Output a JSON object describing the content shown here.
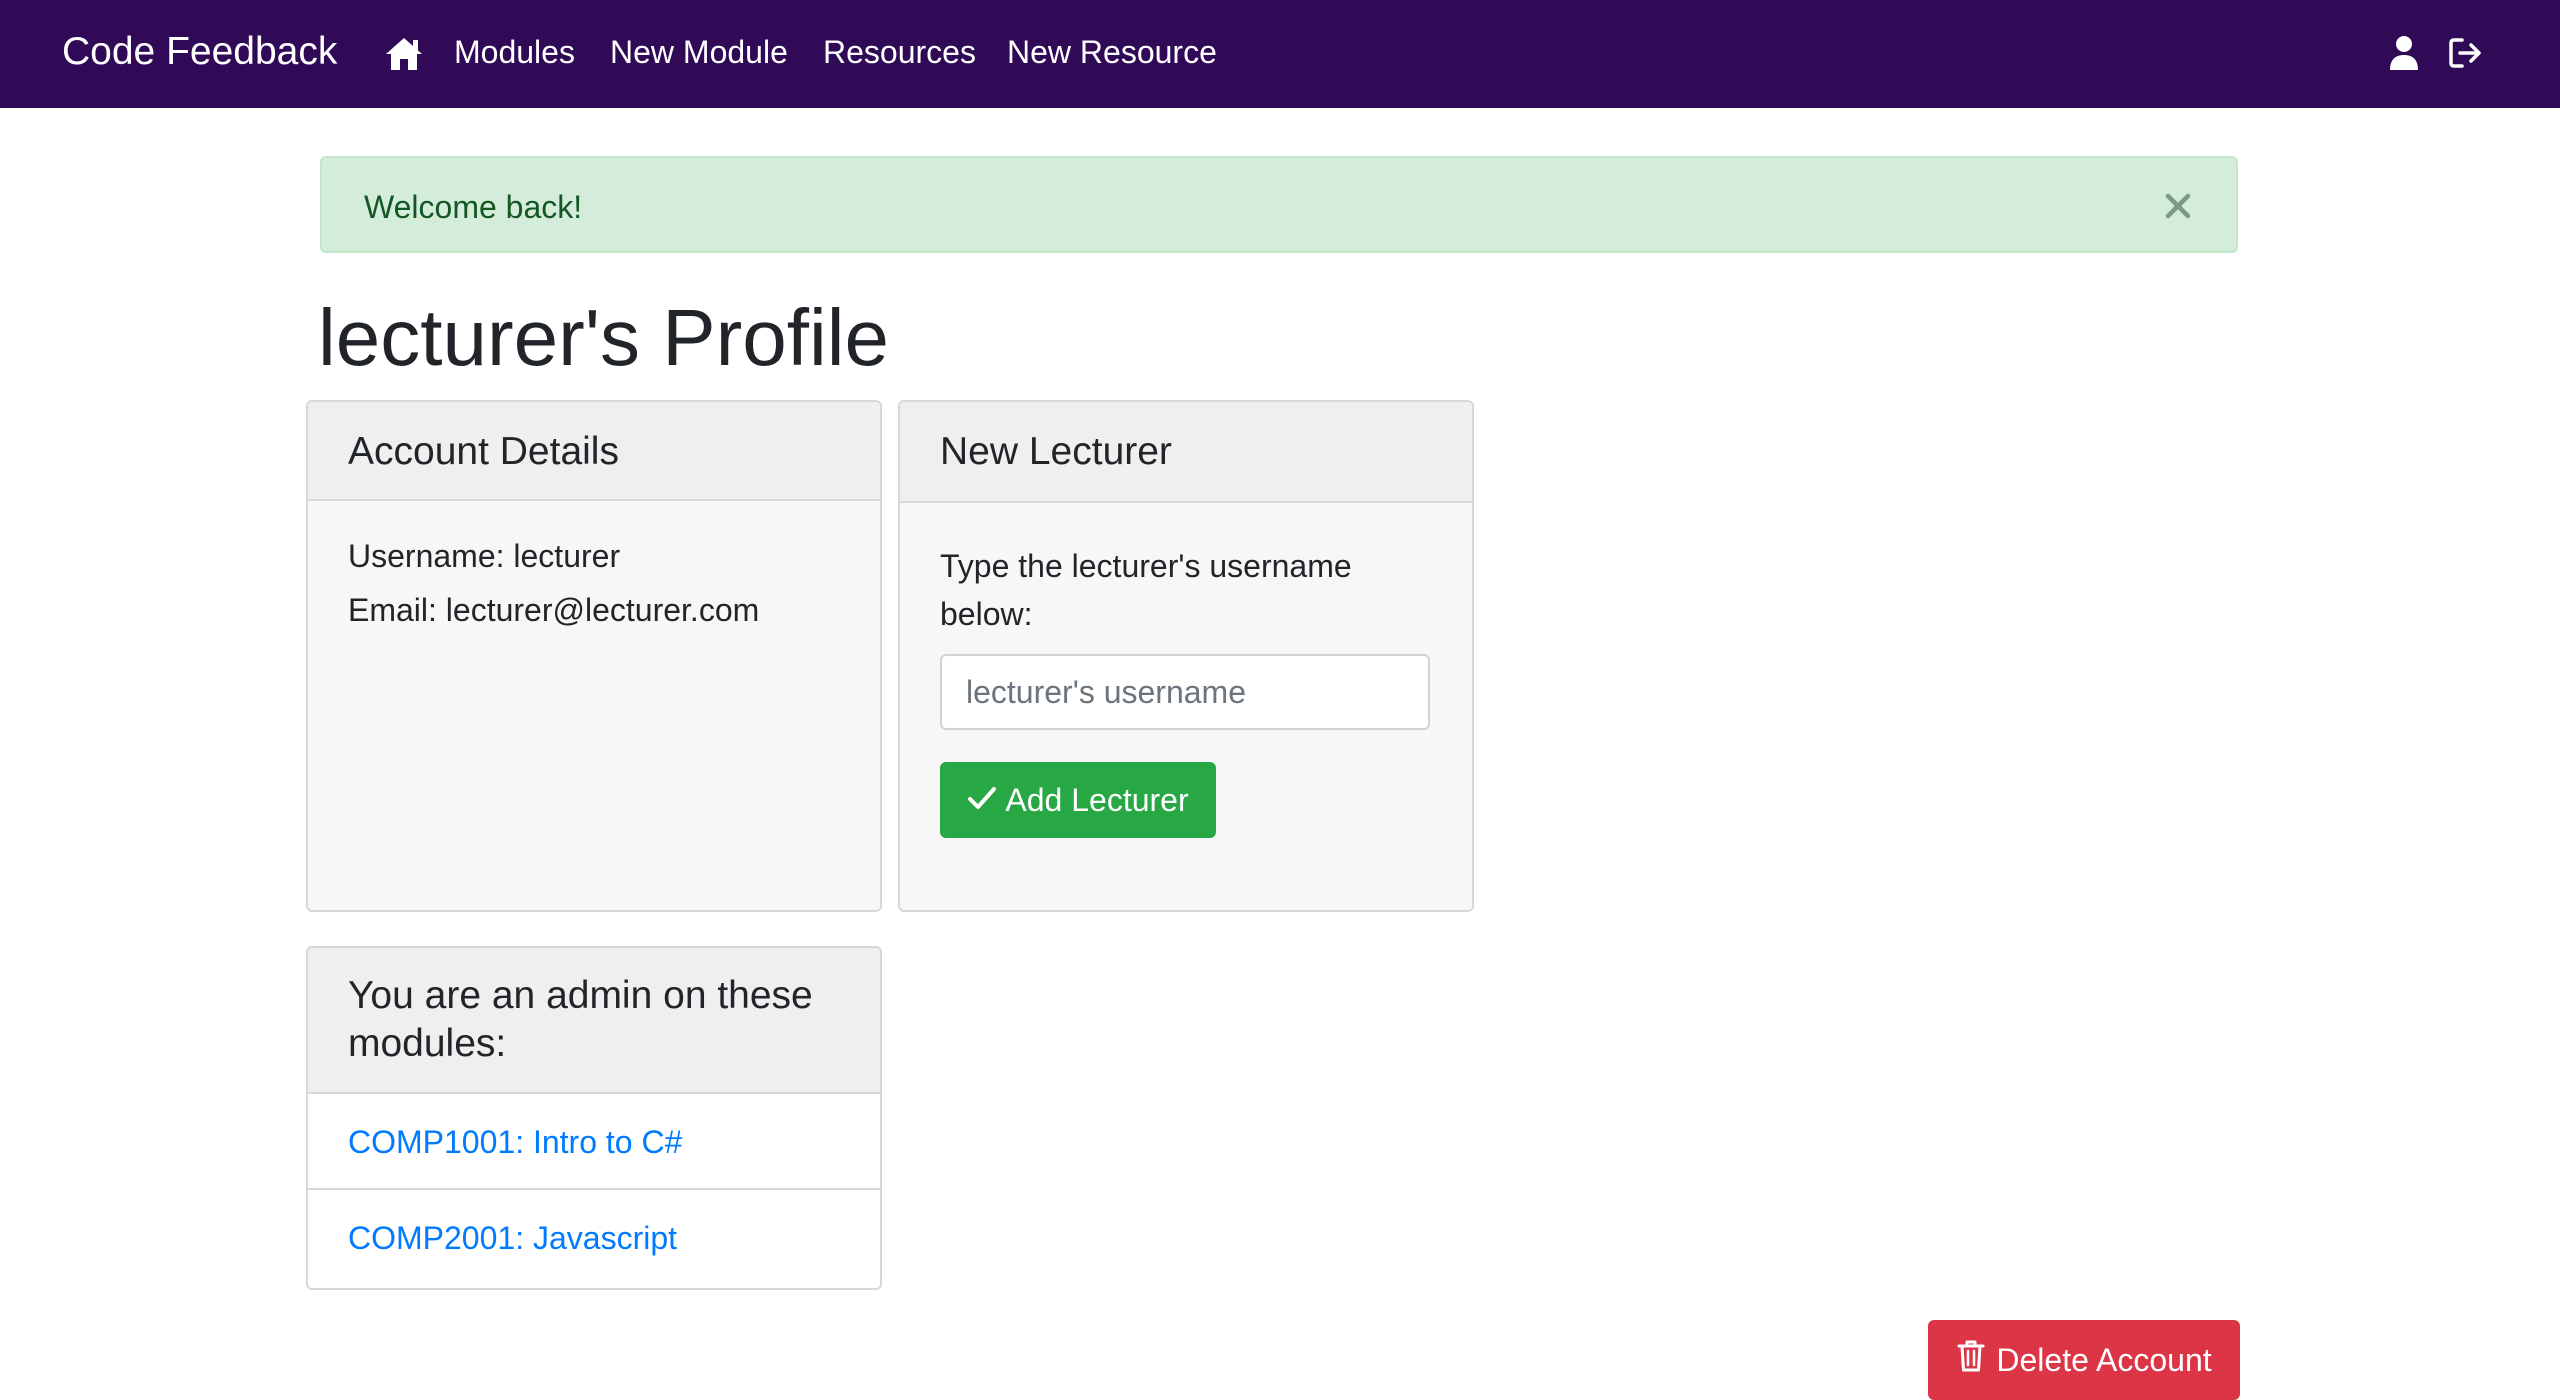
{
  "navbar": {
    "brand": "Code Feedback",
    "home_icon": "home-icon",
    "links": [
      "Modules",
      "New Module",
      "Resources",
      "New Resource"
    ],
    "right_icons": [
      "user-icon",
      "sign-out-icon"
    ],
    "background": "#310a57"
  },
  "alert": {
    "message": "Welcome back!",
    "close_icon": "close-icon",
    "background": "#d4edda",
    "text_color": "#155724"
  },
  "page": {
    "title": "lecturer's Profile"
  },
  "account_details": {
    "header": "Account Details",
    "username_line": "Username: lecturer",
    "email_line": "Email: lecturer@lecturer.com"
  },
  "new_lecturer": {
    "header": "New Lecturer",
    "instructions_line1": "Type the lecturer's username",
    "instructions_line2": "below:",
    "input_value": "",
    "input_placeholder": "lecturer's username",
    "button_label": "Add Lecturer",
    "button_icon": "check-icon",
    "button_color": "#28a745"
  },
  "admin_modules": {
    "header_line1": "You are an admin on these",
    "header_line2": "modules:",
    "items": [
      "COMP1001: Intro to C#",
      "COMP2001: Javascript"
    ],
    "link_color": "#007bff"
  },
  "actions": {
    "delete_label": "Delete Account",
    "delete_icon": "trash-icon",
    "delete_color": "#dc3545"
  }
}
